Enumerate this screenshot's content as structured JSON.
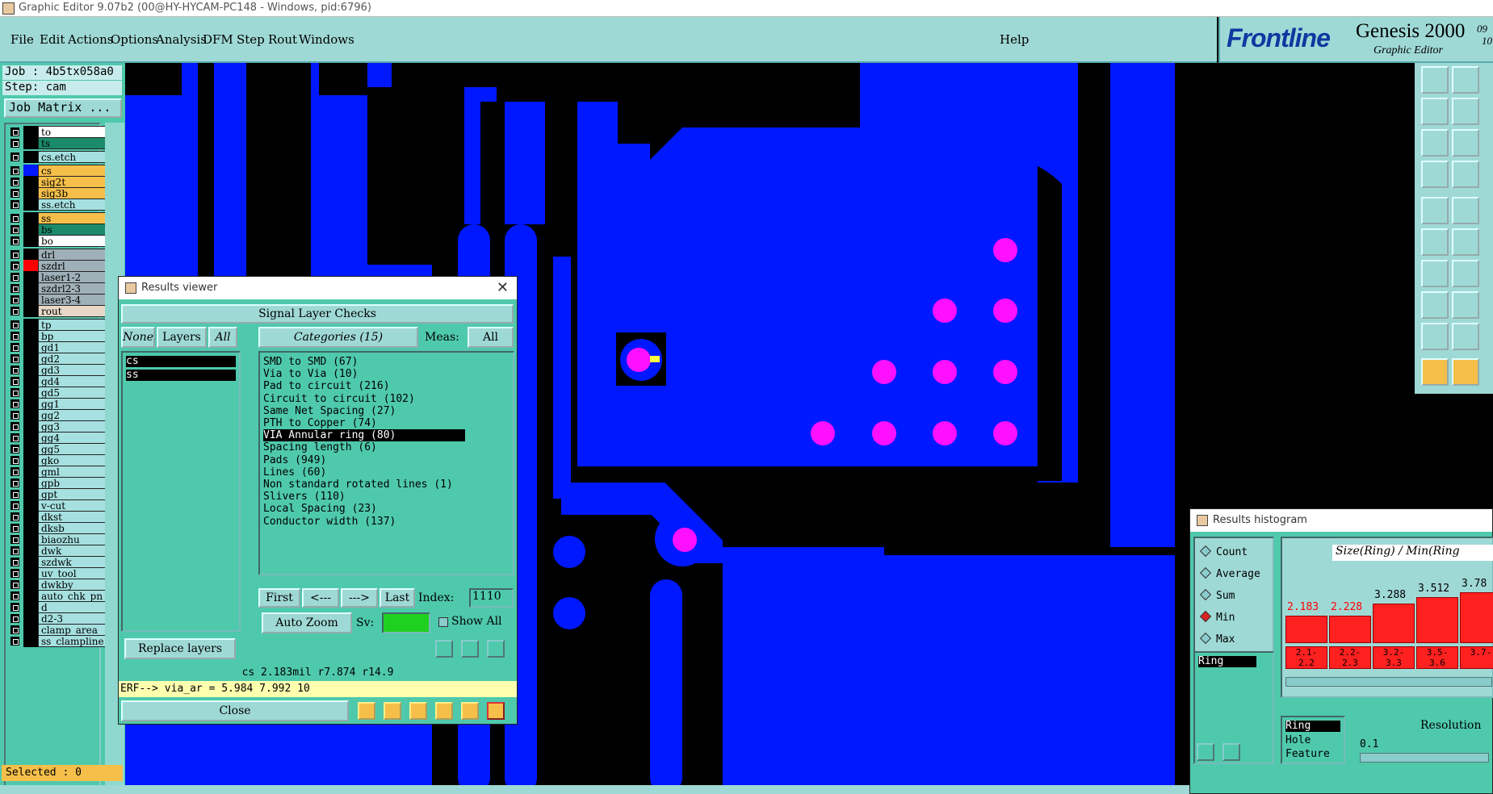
{
  "window": {
    "title": "Graphic Editor 9.07b2 (00@HY-HYCAM-PC148 - Windows, pid:6796)"
  },
  "menu": {
    "items": [
      "File",
      "Edit",
      "Actions",
      "Options",
      "Analysis",
      "DFM",
      "Step",
      "Rout",
      "Windows"
    ],
    "help": "Help"
  },
  "logo": {
    "brand": "Frontline",
    "product": "Genesis 2000",
    "subtitle": "Graphic Editor",
    "ver1": "09",
    "ver2": "10"
  },
  "job": {
    "job": "Job : 4b5tx058a0",
    "step": "Step: cam",
    "matrix_btn": "Job Matrix ..."
  },
  "layers": [
    {
      "name": "to",
      "color": "#ffffff"
    },
    {
      "name": "ts",
      "color": "#1a8a6a"
    },
    {
      "name": "cs.etch",
      "color": "#a6e0e0"
    },
    {
      "name": "cs",
      "color": "#f5bf4a",
      "swatch": "#0018ff"
    },
    {
      "name": "sig2t",
      "color": "#f5bf4a"
    },
    {
      "name": "sig3b",
      "color": "#f5bf4a"
    },
    {
      "name": "ss.etch",
      "color": "#a6e0e0"
    },
    {
      "name": "ss",
      "color": "#f5bf4a"
    },
    {
      "name": "bs",
      "color": "#1a8a6a"
    },
    {
      "name": "bo",
      "color": "#ffffff"
    },
    {
      "name": "drl",
      "color": "#9fb0b8"
    },
    {
      "name": "szdrl",
      "color": "#9fb0b8",
      "swatch": "#ff0000"
    },
    {
      "name": "laser1-2",
      "color": "#9fb0b8"
    },
    {
      "name": "szdrl2-3",
      "color": "#9fb0b8"
    },
    {
      "name": "laser3-4",
      "color": "#9fb0b8"
    },
    {
      "name": "rout",
      "color": "#e8d8c8"
    },
    {
      "name": "tp",
      "color": "#a6e0e0"
    },
    {
      "name": "bp",
      "color": "#a6e0e0"
    },
    {
      "name": "gd1",
      "color": "#a6e0e0"
    },
    {
      "name": "gd2",
      "color": "#a6e0e0"
    },
    {
      "name": "gd3",
      "color": "#a6e0e0"
    },
    {
      "name": "gd4",
      "color": "#a6e0e0"
    },
    {
      "name": "gd5",
      "color": "#a6e0e0"
    },
    {
      "name": "gg1",
      "color": "#a6e0e0"
    },
    {
      "name": "gg2",
      "color": "#a6e0e0"
    },
    {
      "name": "gg3",
      "color": "#a6e0e0"
    },
    {
      "name": "gg4",
      "color": "#a6e0e0"
    },
    {
      "name": "gg5",
      "color": "#a6e0e0"
    },
    {
      "name": "gko",
      "color": "#a6e0e0"
    },
    {
      "name": "gml",
      "color": "#a6e0e0"
    },
    {
      "name": "gpb",
      "color": "#a6e0e0"
    },
    {
      "name": "gpt",
      "color": "#a6e0e0"
    },
    {
      "name": "v-cut",
      "color": "#a6e0e0"
    },
    {
      "name": "dkst",
      "color": "#a6e0e0"
    },
    {
      "name": "dksb",
      "color": "#a6e0e0"
    },
    {
      "name": "biaozhu",
      "color": "#a6e0e0"
    },
    {
      "name": "dwk",
      "color": "#a6e0e0"
    },
    {
      "name": "szdwk",
      "color": "#a6e0e0"
    },
    {
      "name": "uv_tool",
      "color": "#a6e0e0"
    },
    {
      "name": "dwkby",
      "color": "#a6e0e0"
    },
    {
      "name": "auto_chk_pn",
      "color": "#a6e0e0"
    },
    {
      "name": "d",
      "color": "#a6e0e0"
    },
    {
      "name": "d2-3",
      "color": "#a6e0e0"
    },
    {
      "name": "clamp_area",
      "color": "#a6e0e0"
    },
    {
      "name": "ss_clampline",
      "color": "#a6e0e0"
    }
  ],
  "status": {
    "selected": "Selected : 0"
  },
  "results": {
    "title": "Results viewer",
    "header": "Signal Layer Checks",
    "none": "None",
    "layers": "Layers",
    "all": "All",
    "categories_btn": "Categories (15)",
    "meas_label": "Meas:",
    "meas_value": "All",
    "layer_items": [
      "cs",
      "ss"
    ],
    "categories": [
      "SMD to SMD (67)",
      "Via to Via (10)",
      "Pad to circuit (216)",
      "Circuit to circuit (102)",
      "Same Net Spacing (27)",
      "PTH to Copper (74)",
      "VIA Annular ring (80)",
      "Spacing length (6)",
      "Pads (949)",
      "Lines (60)",
      "Non standard rotated lines (1)",
      "Slivers (110)",
      "Local Spacing (23)",
      "Conductor width (137)"
    ],
    "first": "First",
    "prev": "<---",
    "next": "--->",
    "last": "Last",
    "index_label": "Index:",
    "index_value": "1110",
    "autozoom": "Auto Zoom",
    "sv": "Sv:",
    "showall": "Show All",
    "replace": "Replace layers",
    "info": "cs 2.183mil  r7.874  r14.9",
    "erf": "ERF--> via_ar = 5.984 7.992 10",
    "close": "Close"
  },
  "histogram": {
    "title": "Results histogram",
    "radios": [
      "Count",
      "Average",
      "Sum",
      "Min",
      "Max"
    ],
    "selected_radio": "Min",
    "list_item": "Ring",
    "header": "Size(Ring) / Min(Ring",
    "values": [
      "2.183",
      "2.228",
      "3.288",
      "3.512",
      "3.78"
    ],
    "bins": [
      "2.1-\n2.2",
      "2.2-\n2.3",
      "3.2-\n3.3",
      "3.5-\n3.6",
      "3.7-"
    ],
    "feature_items": [
      "Ring",
      "Hole",
      "Feature"
    ],
    "resolution_label": "Resolution",
    "resolution_value": "0.1"
  },
  "colors": {
    "copper": "#0018ff",
    "pad": "#ff10ff",
    "panel": "#4fc9ac",
    "header": "#9fd9d6"
  }
}
